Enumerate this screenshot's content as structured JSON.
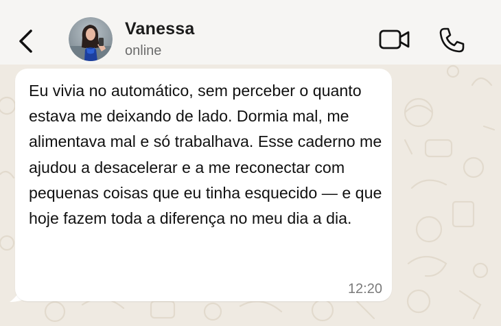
{
  "header": {
    "back_icon": "chevron-left-icon",
    "contact_name": "Vanessa",
    "contact_status": "online",
    "video_icon": "video-camera-icon",
    "call_icon": "phone-icon",
    "avatar_icon": "user-avatar"
  },
  "conversation": {
    "message": {
      "text": "Eu vivia no automático, sem perceber o quanto estava me deixando de lado. Dormia mal, me alimentava mal e só trabalhava. Esse caderno me ajudou a desacelerar e a me reconectar com pequenas coisas que eu tinha esquecido — e que hoje fazem toda a diferença no meu dia a dia.",
      "time": "12:20"
    }
  },
  "colors": {
    "header_bg": "#f6f5f3",
    "wallpaper_bg": "#efeae2",
    "bubble_bg": "#ffffff",
    "text": "#111111",
    "secondary_text": "#6b6b6b"
  }
}
